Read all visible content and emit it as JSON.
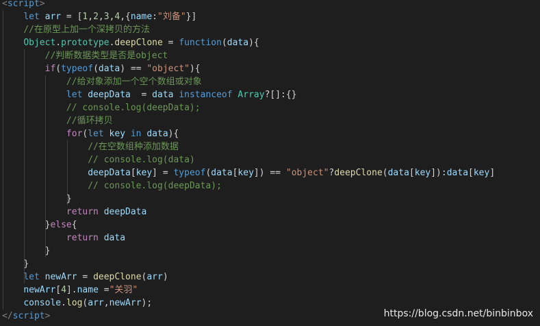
{
  "code_lines": [
    [
      {
        "t": "<",
        "c": "tagp"
      },
      {
        "t": "script",
        "c": "tag"
      },
      {
        "t": ">",
        "c": "tagp"
      }
    ],
    [
      {
        "t": "    ",
        "c": "plain"
      },
      {
        "t": "let",
        "c": "kw-blue"
      },
      {
        "t": " ",
        "c": "plain"
      },
      {
        "t": "arr",
        "c": "var"
      },
      {
        "t": " = [",
        "c": "plain"
      },
      {
        "t": "1",
        "c": "num"
      },
      {
        "t": ",",
        "c": "plain"
      },
      {
        "t": "2",
        "c": "num"
      },
      {
        "t": ",",
        "c": "plain"
      },
      {
        "t": "3",
        "c": "num"
      },
      {
        "t": ",",
        "c": "plain"
      },
      {
        "t": "4",
        "c": "num"
      },
      {
        "t": ",{",
        "c": "plain"
      },
      {
        "t": "name",
        "c": "var"
      },
      {
        "t": ":",
        "c": "plain"
      },
      {
        "t": "\"刘备\"",
        "c": "str"
      },
      {
        "t": "}]",
        "c": "plain"
      }
    ],
    [
      {
        "t": "    ",
        "c": "plain"
      },
      {
        "t": "//在原型上加一个深拷贝的方法",
        "c": "cmt"
      }
    ],
    [
      {
        "t": "    ",
        "c": "plain"
      },
      {
        "t": "Object",
        "c": "cls"
      },
      {
        "t": ".",
        "c": "plain"
      },
      {
        "t": "prototype",
        "c": "cls"
      },
      {
        "t": ".",
        "c": "plain"
      },
      {
        "t": "deepClone",
        "c": "fn"
      },
      {
        "t": " = ",
        "c": "plain"
      },
      {
        "t": "function",
        "c": "kw-blue"
      },
      {
        "t": "(",
        "c": "plain"
      },
      {
        "t": "data",
        "c": "var"
      },
      {
        "t": "){",
        "c": "plain"
      }
    ],
    [
      {
        "t": "        ",
        "c": "plain"
      },
      {
        "t": "//判断数据类型是否是object",
        "c": "cmt"
      }
    ],
    [
      {
        "t": "        ",
        "c": "plain"
      },
      {
        "t": "if",
        "c": "kw-purple"
      },
      {
        "t": "(",
        "c": "plain"
      },
      {
        "t": "typeof",
        "c": "kw-blue"
      },
      {
        "t": "(",
        "c": "plain"
      },
      {
        "t": "data",
        "c": "var"
      },
      {
        "t": ") == ",
        "c": "plain"
      },
      {
        "t": "\"object\"",
        "c": "str"
      },
      {
        "t": "){",
        "c": "plain"
      }
    ],
    [
      {
        "t": "            ",
        "c": "plain"
      },
      {
        "t": "//给对象添加一个空个数组或对象",
        "c": "cmt"
      }
    ],
    [
      {
        "t": "            ",
        "c": "plain"
      },
      {
        "t": "let",
        "c": "kw-blue"
      },
      {
        "t": " ",
        "c": "plain"
      },
      {
        "t": "deepData",
        "c": "var"
      },
      {
        "t": "  = ",
        "c": "plain"
      },
      {
        "t": "data",
        "c": "var"
      },
      {
        "t": " ",
        "c": "plain"
      },
      {
        "t": "instanceof",
        "c": "kw-blue"
      },
      {
        "t": " ",
        "c": "plain"
      },
      {
        "t": "Array",
        "c": "cls"
      },
      {
        "t": "?[]:{}",
        "c": "plain"
      }
    ],
    [
      {
        "t": "            ",
        "c": "plain"
      },
      {
        "t": "// console.log(deepData);",
        "c": "cmt"
      }
    ],
    [
      {
        "t": "            ",
        "c": "plain"
      },
      {
        "t": "//循环拷贝",
        "c": "cmt"
      }
    ],
    [
      {
        "t": "            ",
        "c": "plain"
      },
      {
        "t": "for",
        "c": "kw-purple"
      },
      {
        "t": "(",
        "c": "plain"
      },
      {
        "t": "let",
        "c": "kw-blue"
      },
      {
        "t": " ",
        "c": "plain"
      },
      {
        "t": "key",
        "c": "var"
      },
      {
        "t": " ",
        "c": "plain"
      },
      {
        "t": "in",
        "c": "kw-blue"
      },
      {
        "t": " ",
        "c": "plain"
      },
      {
        "t": "data",
        "c": "var"
      },
      {
        "t": "){",
        "c": "plain"
      }
    ],
    [
      {
        "t": "                ",
        "c": "plain"
      },
      {
        "t": "//在空数组种添加数据",
        "c": "cmt"
      }
    ],
    [
      {
        "t": "                ",
        "c": "plain"
      },
      {
        "t": "// console.log(data)",
        "c": "cmt"
      }
    ],
    [
      {
        "t": "                ",
        "c": "plain"
      },
      {
        "t": "deepData",
        "c": "var"
      },
      {
        "t": "[",
        "c": "plain"
      },
      {
        "t": "key",
        "c": "var"
      },
      {
        "t": "] = ",
        "c": "plain"
      },
      {
        "t": "typeof",
        "c": "kw-blue"
      },
      {
        "t": "(",
        "c": "plain"
      },
      {
        "t": "data",
        "c": "var"
      },
      {
        "t": "[",
        "c": "plain"
      },
      {
        "t": "key",
        "c": "var"
      },
      {
        "t": "]) == ",
        "c": "plain"
      },
      {
        "t": "\"object\"",
        "c": "str"
      },
      {
        "t": "?",
        "c": "plain"
      },
      {
        "t": "deepClone",
        "c": "fn"
      },
      {
        "t": "(",
        "c": "plain"
      },
      {
        "t": "data",
        "c": "var"
      },
      {
        "t": "[",
        "c": "plain"
      },
      {
        "t": "key",
        "c": "var"
      },
      {
        "t": "]):",
        "c": "plain"
      },
      {
        "t": "data",
        "c": "var"
      },
      {
        "t": "[",
        "c": "plain"
      },
      {
        "t": "key",
        "c": "var"
      },
      {
        "t": "]",
        "c": "plain"
      }
    ],
    [
      {
        "t": "                ",
        "c": "plain"
      },
      {
        "t": "// console.log(deepData);",
        "c": "cmt"
      }
    ],
    [
      {
        "t": "            ",
        "c": "plain"
      },
      {
        "t": "}",
        "c": "plain"
      }
    ],
    [
      {
        "t": "            ",
        "c": "plain"
      },
      {
        "t": "return",
        "c": "kw-purple"
      },
      {
        "t": " ",
        "c": "plain"
      },
      {
        "t": "deepData",
        "c": "var"
      }
    ],
    [
      {
        "t": "        ",
        "c": "plain"
      },
      {
        "t": "}",
        "c": "plain"
      },
      {
        "t": "else",
        "c": "kw-purple"
      },
      {
        "t": "{",
        "c": "plain"
      }
    ],
    [
      {
        "t": "            ",
        "c": "plain"
      },
      {
        "t": "return",
        "c": "kw-purple"
      },
      {
        "t": " ",
        "c": "plain"
      },
      {
        "t": "data",
        "c": "var"
      }
    ],
    [
      {
        "t": "        ",
        "c": "plain"
      },
      {
        "t": "}",
        "c": "plain"
      }
    ],
    [
      {
        "t": "    ",
        "c": "plain"
      },
      {
        "t": "}",
        "c": "plain"
      }
    ],
    [
      {
        "t": "    ",
        "c": "plain"
      },
      {
        "t": "let",
        "c": "kw-blue"
      },
      {
        "t": " ",
        "c": "plain"
      },
      {
        "t": "newArr",
        "c": "var"
      },
      {
        "t": " = ",
        "c": "plain"
      },
      {
        "t": "deepClone",
        "c": "fn"
      },
      {
        "t": "(",
        "c": "plain"
      },
      {
        "t": "arr",
        "c": "var"
      },
      {
        "t": ")",
        "c": "plain"
      }
    ],
    [
      {
        "t": "    ",
        "c": "plain"
      },
      {
        "t": "newArr",
        "c": "var"
      },
      {
        "t": "[",
        "c": "plain"
      },
      {
        "t": "4",
        "c": "num"
      },
      {
        "t": "].",
        "c": "plain"
      },
      {
        "t": "name",
        "c": "var"
      },
      {
        "t": " =",
        "c": "plain"
      },
      {
        "t": "\"关羽\"",
        "c": "str"
      }
    ],
    [
      {
        "t": "    ",
        "c": "plain"
      },
      {
        "t": "console",
        "c": "var"
      },
      {
        "t": ".",
        "c": "plain"
      },
      {
        "t": "log",
        "c": "fn"
      },
      {
        "t": "(",
        "c": "plain"
      },
      {
        "t": "arr",
        "c": "var"
      },
      {
        "t": ",",
        "c": "plain"
      },
      {
        "t": "newArr",
        "c": "var"
      },
      {
        "t": ");",
        "c": "plain"
      }
    ],
    [
      {
        "t": "</",
        "c": "tagp"
      },
      {
        "t": "script",
        "c": "tag"
      },
      {
        "t": ">",
        "c": "tagp"
      }
    ]
  ],
  "watermark": "https://blog.csdn.net/binbinbox"
}
